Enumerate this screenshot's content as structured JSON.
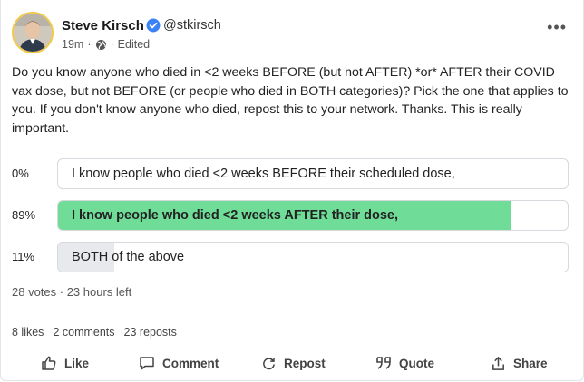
{
  "author": {
    "name": "Steve Kirsch",
    "handle": "@stkirsch",
    "time": "19m",
    "edited": "Edited"
  },
  "post": {
    "text": "Do you know anyone who died in <2 weeks BEFORE (but not AFTER) *or* AFTER their COVID vax dose, but not BEFORE (or people who died in BOTH categories)? Pick the one that applies to you. If you don't know anyone who died, repost this to your network. Thanks. This is really important."
  },
  "poll": {
    "options": [
      {
        "percent_label": "0%",
        "label": "I know people who died <2 weeks BEFORE their scheduled dose,",
        "fraction": 0.0,
        "fill_color": "#e7e9ec",
        "winner": false
      },
      {
        "percent_label": "89%",
        "label": "I know people who died <2 weeks AFTER their dose,",
        "fraction": 0.89,
        "fill_color": "#6fdd98",
        "winner": true
      },
      {
        "percent_label": "11%",
        "label": "BOTH of the above",
        "fraction": 0.11,
        "fill_color": "#e7e9ec",
        "winner": false
      }
    ],
    "votes_text": "28 votes · 23 hours left"
  },
  "stats": {
    "likes": "8 likes",
    "comments": "2 comments",
    "reposts": "23 reposts"
  },
  "actions": {
    "like": "Like",
    "comment": "Comment",
    "repost": "Repost",
    "quote": "Quote",
    "share": "Share"
  },
  "icons": {
    "verified": "verified-badge-icon",
    "visibility": "globe-icon",
    "more": "more-options-icon",
    "like": "thumbs-up-icon",
    "comment": "speech-bubble-icon",
    "repost": "repost-icon",
    "quote": "quote-icon",
    "share": "share-icon"
  },
  "colors": {
    "accent_verified": "#3b82f6",
    "poll_winner": "#6fdd98",
    "poll_other": "#e7e9ec",
    "avatar_ring": "#f2c94c"
  }
}
